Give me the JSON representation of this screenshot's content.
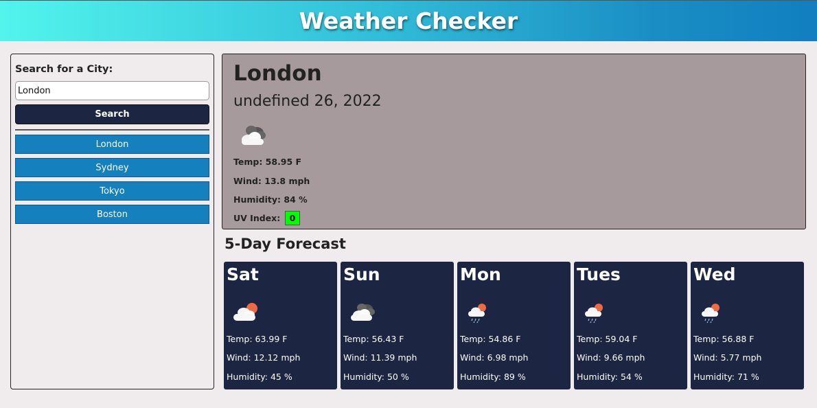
{
  "header": {
    "title": "Weather Checker"
  },
  "sidebar": {
    "search_label": "Search for a City:",
    "search_value": "London",
    "search_button": "Search",
    "history": [
      "London",
      "Sydney",
      "Tokyo",
      "Boston"
    ]
  },
  "current": {
    "city": "London",
    "date": "undefined 26, 2022",
    "icon": "broken-clouds-icon",
    "temp": "Temp: 58.95 F",
    "wind": "Wind: 13.8 mph",
    "humidity": "Humidity: 84 %",
    "uv_label": "UV Index:",
    "uv_value": "0",
    "uv_color": "#00ff00"
  },
  "forecast": {
    "title": "5-Day Forecast",
    "days": [
      {
        "day": "Sat",
        "icon": "few-clouds-icon",
        "temp": "Temp: 63.99 F",
        "wind": "Wind: 12.12 mph",
        "humidity": "Humidity: 45 %"
      },
      {
        "day": "Sun",
        "icon": "broken-clouds-icon",
        "temp": "Temp: 56.43 F",
        "wind": "Wind: 11.39 mph",
        "humidity": "Humidity: 50 %"
      },
      {
        "day": "Mon",
        "icon": "rain-icon",
        "temp": "Temp: 54.86 F",
        "wind": "Wind: 6.98 mph",
        "humidity": "Humidity: 89 %"
      },
      {
        "day": "Tues",
        "icon": "rain-icon",
        "temp": "Temp: 59.04 F",
        "wind": "Wind: 9.66 mph",
        "humidity": "Humidity: 54 %"
      },
      {
        "day": "Wed",
        "icon": "rain-icon",
        "temp": "Temp: 56.88 F",
        "wind": "Wind: 5.77 mph",
        "humidity": "Humidity: 71 %"
      }
    ]
  },
  "colors": {
    "header_gradient_start": "#52f4ec",
    "header_gradient_end": "#117fc0",
    "card_bg": "#1c2541",
    "history_button": "#1480be",
    "current_panel_bg": "#a69a9c"
  }
}
